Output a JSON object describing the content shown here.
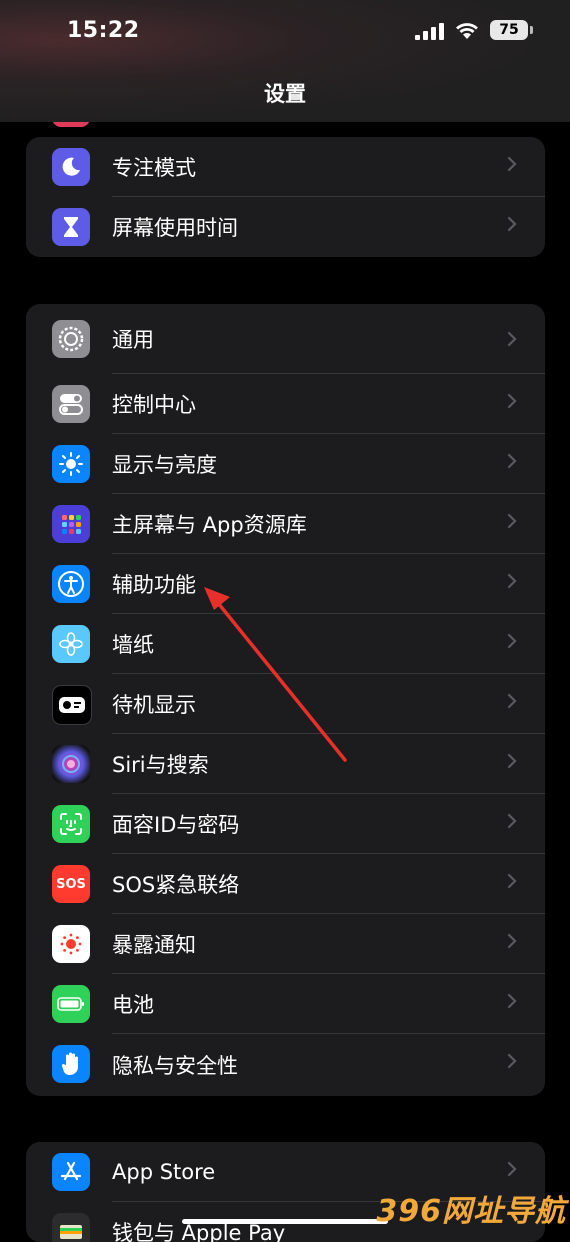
{
  "status": {
    "time": "15:22",
    "battery": "75"
  },
  "nav": {
    "title": "设置"
  },
  "group1": [
    {
      "label": "专注模式",
      "icon": "moon-icon",
      "color": "#5e5ce6"
    },
    {
      "label": "屏幕使用时间",
      "icon": "hourglass-icon",
      "color": "#5e5ce6"
    }
  ],
  "group2": [
    {
      "label": "通用",
      "icon": "gear-icon",
      "color": "#8e8e93"
    },
    {
      "label": "控制中心",
      "icon": "toggles-icon",
      "color": "#8e8e93"
    },
    {
      "label": "显示与亮度",
      "icon": "sun-icon",
      "color": "#0a84ff"
    },
    {
      "label": "主屏幕与 App资源库",
      "icon": "apps-grid-icon",
      "color": "#5e5ce6"
    },
    {
      "label": "辅助功能",
      "icon": "accessibility-icon",
      "color": "#0a84ff"
    },
    {
      "label": "墙纸",
      "icon": "flower-icon",
      "color": "#5ac8fa"
    },
    {
      "label": "待机显示",
      "icon": "standby-icon",
      "color": "#000000"
    },
    {
      "label": "Siri与搜索",
      "icon": "siri-icon",
      "color": "#1c1c1e"
    },
    {
      "label": "面容ID与密码",
      "icon": "faceid-icon",
      "color": "#30d158"
    },
    {
      "label": "SOS紧急联络",
      "icon": "sos-icon",
      "color": "#ff3b30"
    },
    {
      "label": "暴露通知",
      "icon": "exposure-icon",
      "color": "#ffffff"
    },
    {
      "label": "电池",
      "icon": "battery-icon",
      "color": "#30d158"
    },
    {
      "label": "隐私与安全性",
      "icon": "hand-icon",
      "color": "#0a84ff"
    }
  ],
  "group3": [
    {
      "label": "App Store",
      "icon": "appstore-icon",
      "color": "#0a84ff"
    },
    {
      "label": "钱包与 Apple Pay",
      "icon": "wallet-icon",
      "color": "#2c2c2e"
    }
  ],
  "watermark": "396网址导航",
  "colors": {
    "annotation_arrow": "#e8302a",
    "group_bg": "#1c1c1e"
  }
}
